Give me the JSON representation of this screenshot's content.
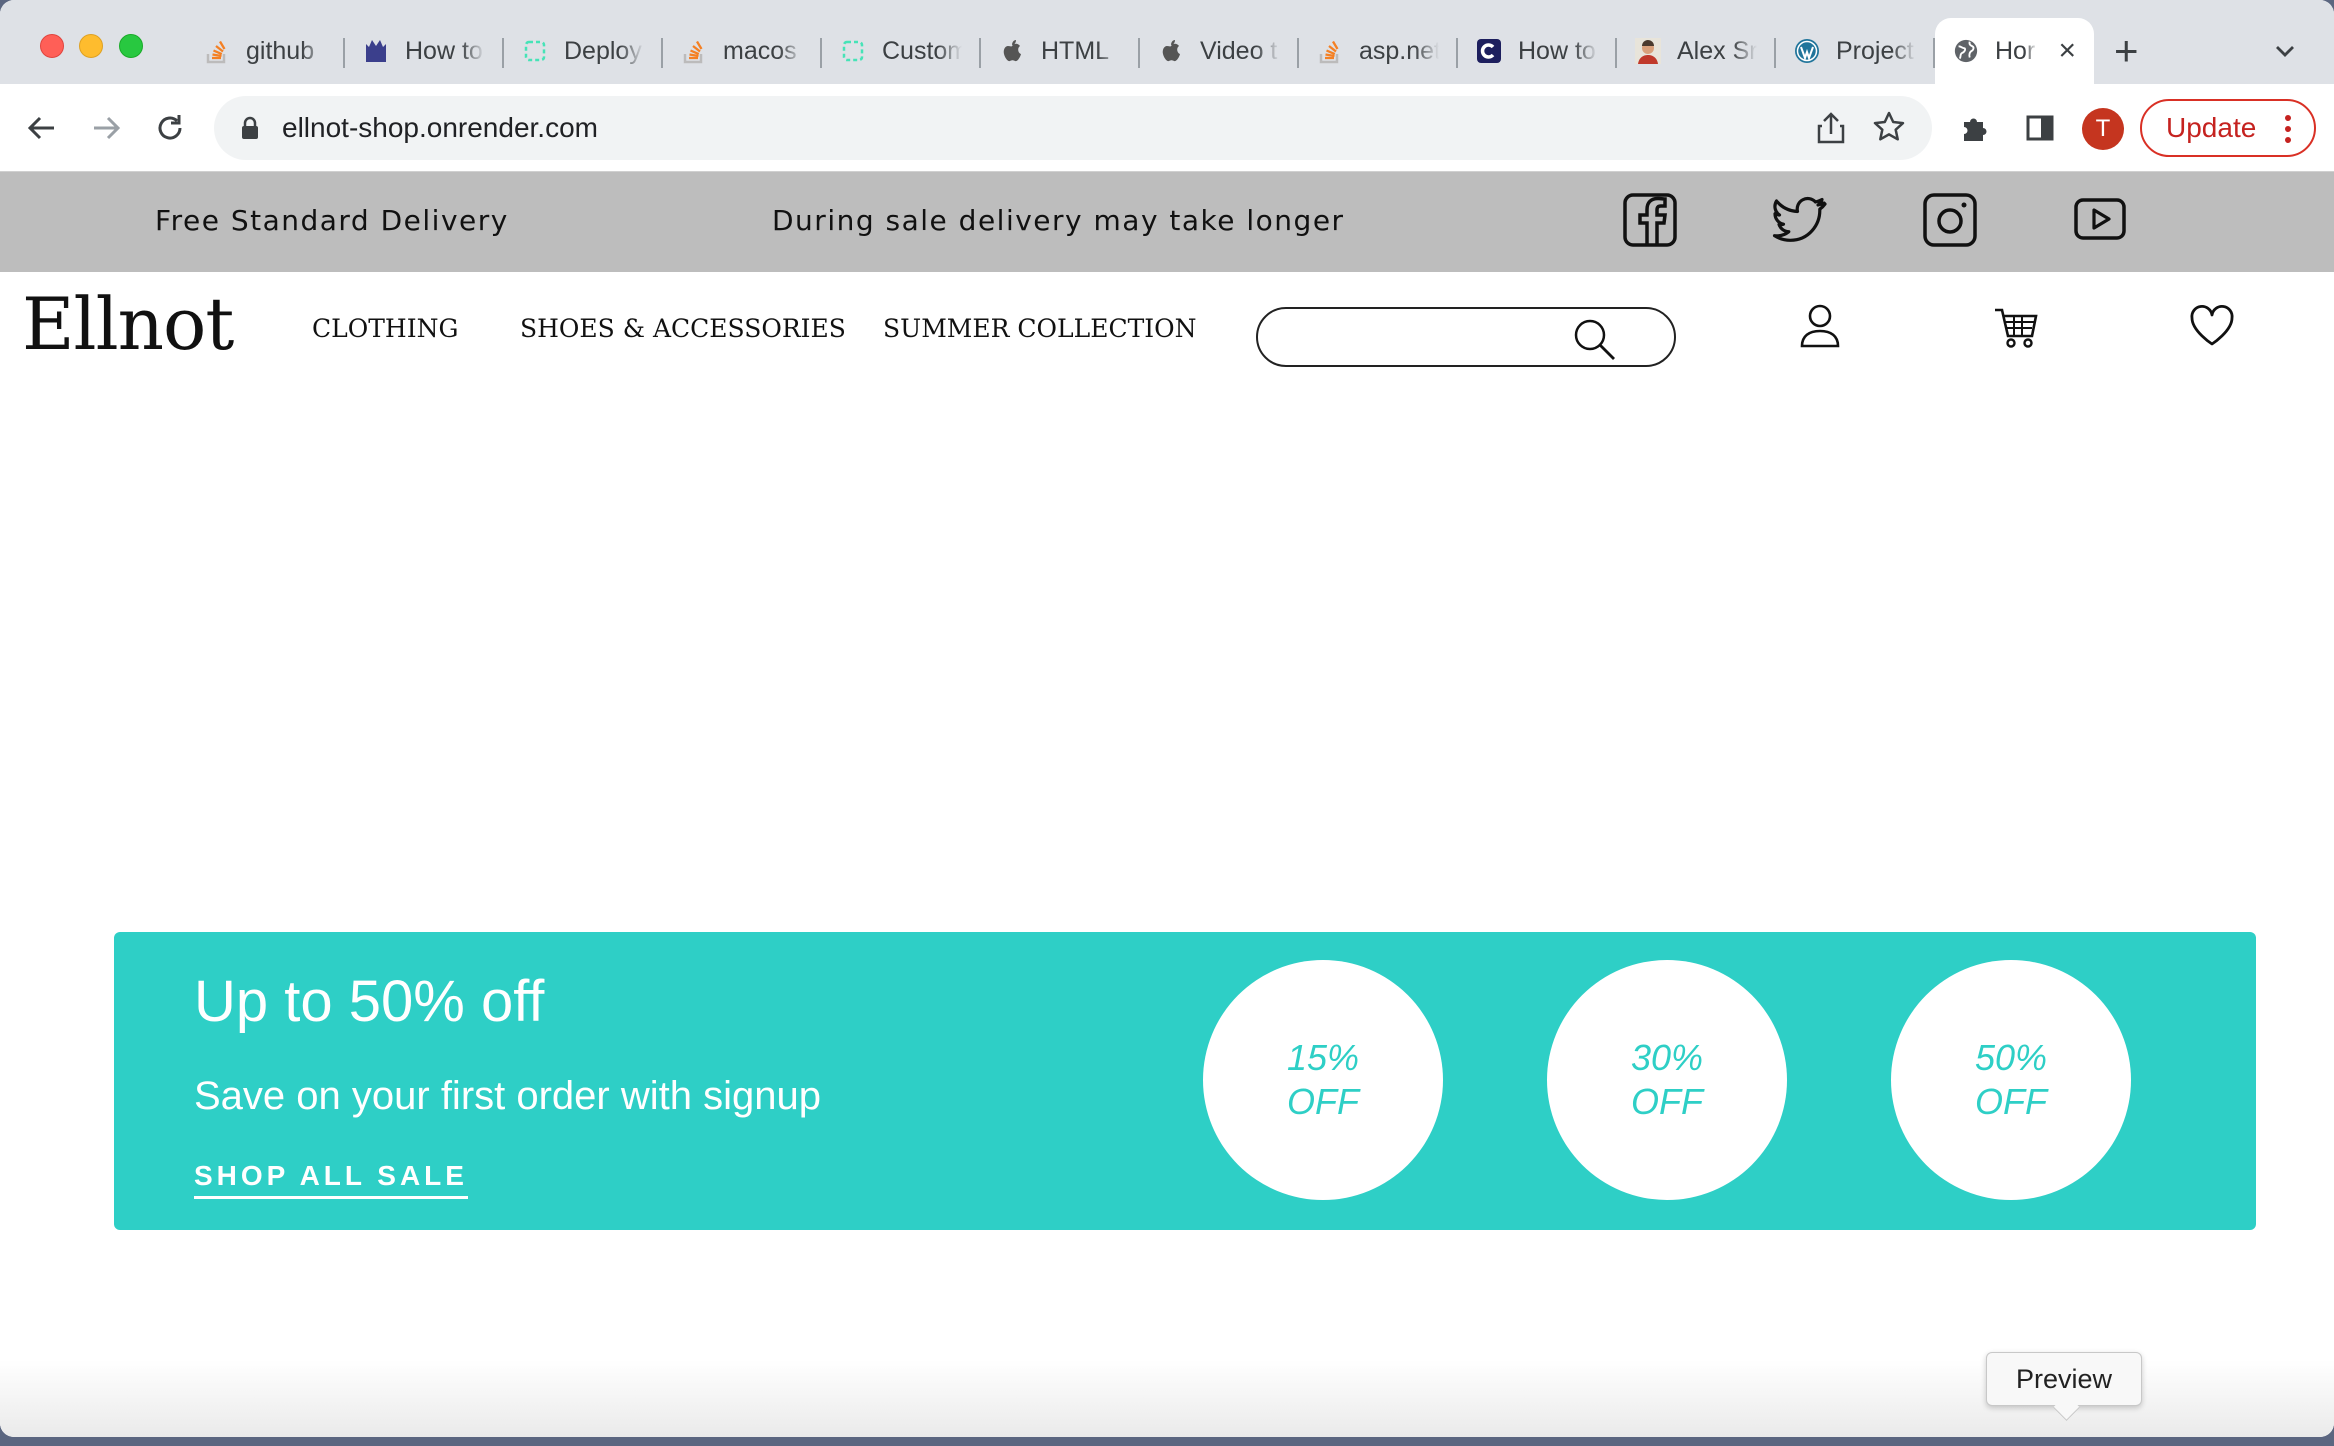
{
  "browser": {
    "tabs": [
      {
        "label": "github",
        "icon": "stackoverflow-icon"
      },
      {
        "label": "How to",
        "icon": "castle-icon"
      },
      {
        "label": "Deploy",
        "icon": "render-icon"
      },
      {
        "label": "macos",
        "icon": "stackoverflow-icon"
      },
      {
        "label": "Custom",
        "icon": "render-icon"
      },
      {
        "label": "HTML",
        "icon": "apple-icon"
      },
      {
        "label": "Video t",
        "icon": "apple-icon"
      },
      {
        "label": "asp.net",
        "icon": "stackoverflow-icon"
      },
      {
        "label": "How to",
        "icon": "c-logo-icon"
      },
      {
        "label": "Alex Sr",
        "icon": "person-icon"
      },
      {
        "label": "Project",
        "icon": "wordpress-icon"
      }
    ],
    "active_tab": {
      "label": "Hor",
      "icon": "globe-icon"
    },
    "url": "ellnot-shop.onrender.com",
    "profile_initial": "T",
    "update_label": "Update"
  },
  "site": {
    "topbar": {
      "delivery": "Free Standard Delivery",
      "sale_notice": "During sale delivery may take longer",
      "social": [
        "facebook-icon",
        "twitter-icon",
        "instagram-icon",
        "youtube-icon"
      ]
    },
    "logo": "Ellnot",
    "menu": [
      "CLOTHING",
      "SHOES & ACCESSORIES",
      "SUMMER COLLECTION"
    ],
    "search_placeholder": "",
    "promo": {
      "headline": "Up to 50% off",
      "subtitle": "Save on your first order with signup",
      "cta": "SHOP ALL SALE",
      "discounts": [
        {
          "pct": "15%",
          "label": "OFF"
        },
        {
          "pct": "30%",
          "label": "OFF"
        },
        {
          "pct": "50%",
          "label": "OFF"
        }
      ]
    },
    "tooltip": "Preview"
  },
  "colors": {
    "accent": "#2ecfc6",
    "topbar": "#bdbdbd",
    "update_red": "#d93025"
  }
}
